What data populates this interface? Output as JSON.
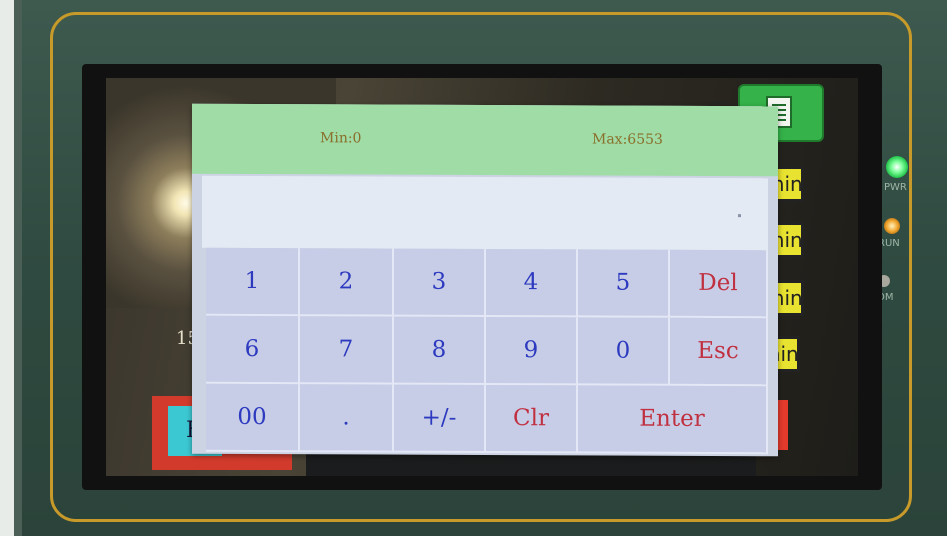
{
  "device": {
    "leds": [
      {
        "label": "PWR",
        "color": "#35e86a"
      },
      {
        "label": "RUN",
        "color": "#f0a32a"
      },
      {
        "label": "COM",
        "color": "#9a9a92"
      }
    ]
  },
  "background_screen": {
    "partial_text_1": "15/",
    "partial_text_2": "1",
    "side_buttons": [
      "min",
      "min",
      "min",
      "min"
    ],
    "bottom_button": "F"
  },
  "keypad": {
    "min_label": "Min:0",
    "max_label": "Max:6553",
    "display_value": "",
    "keys": {
      "k1": "1",
      "k2": "2",
      "k3": "3",
      "k4": "4",
      "k5": "5",
      "del": "Del",
      "k6": "6",
      "k7": "7",
      "k8": "8",
      "k9": "9",
      "k0": "0",
      "esc": "Esc",
      "k00": "00",
      "dot": ".",
      "sign": "+/-",
      "clr": "Clr",
      "enter": "Enter"
    },
    "colors": {
      "digit": "#2d3ac0",
      "action": "#c03040",
      "header": "#9fdca6",
      "key_bg": "#c7cde6"
    }
  }
}
